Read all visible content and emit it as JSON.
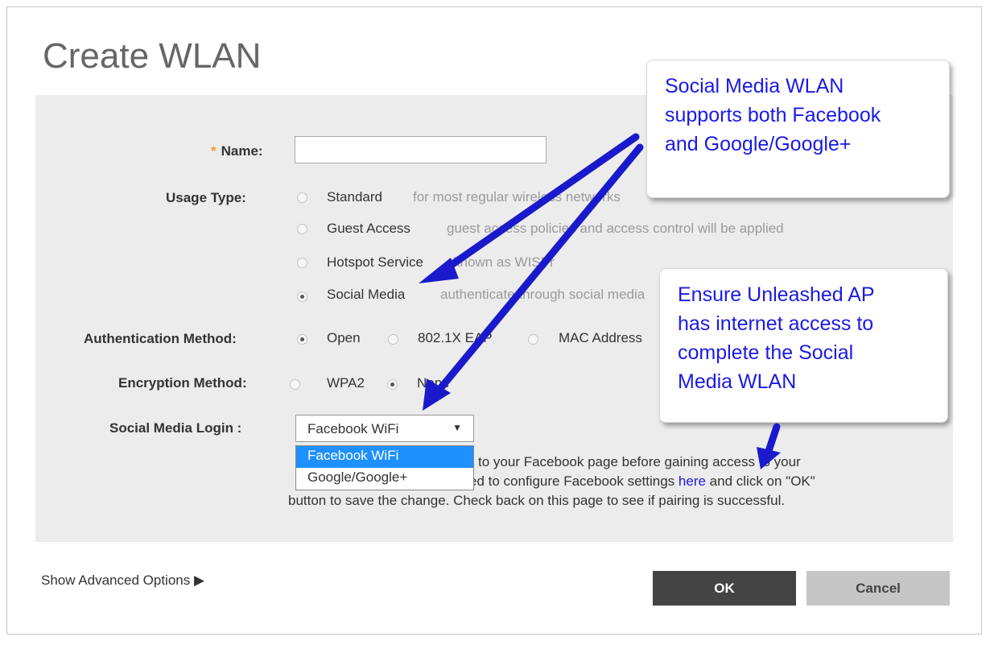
{
  "dialog": {
    "title": "Create WLAN"
  },
  "form": {
    "name_label": "Name:",
    "name_required": "*",
    "name_value": "",
    "usage_label": "Usage Type:",
    "usage_options": [
      {
        "label": "Standard",
        "hint": "for most regular wireless networks",
        "checked": false
      },
      {
        "label": "Guest Access",
        "hint": "guest access policies and access control will be applied",
        "checked": false
      },
      {
        "label": "Hotspot Service",
        "hint": "known as WISPr",
        "checked": false
      },
      {
        "label": "Social Media",
        "hint": "authenticate through social media",
        "checked": true
      }
    ],
    "auth_label": "Authentication Method:",
    "auth_options": [
      {
        "label": "Open",
        "checked": true
      },
      {
        "label": "802.1X EAP",
        "checked": false
      },
      {
        "label": "MAC Address",
        "checked": false
      }
    ],
    "enc_label": "Encryption Method:",
    "enc_options": [
      {
        "label": "WPA2",
        "checked": false
      },
      {
        "label": "None",
        "checked": true
      }
    ],
    "social_label": "Social Media Login :",
    "social_selected": "Facebook WiFi",
    "social_options": [
      "Facebook WiFi",
      "Google/Google+"
    ],
    "note_part1": "to your Facebook page before gaining access to your",
    "note_part2": "ed to configure Facebook settings",
    "note_link": "here",
    "note_part3": "and click on \"OK\"",
    "note_part4": "button to save the change. Check back on this page to see if pairing is successful."
  },
  "footer": {
    "advanced": "Show Advanced Options",
    "ok": "OK",
    "cancel": "Cancel"
  },
  "callouts": {
    "first": [
      "Social Media WLAN",
      "supports both Facebook",
      "and Google/Google+"
    ],
    "second": [
      "Ensure Unleashed AP",
      "has internet access to",
      "complete the Social",
      "Media WLAN"
    ]
  },
  "colors": {
    "callout_text": "#1a1ae6",
    "arrow": "#1a1acc",
    "ok_button": "#444444",
    "cancel_button": "#c6c6c6",
    "dropdown_highlight": "#1e90ff"
  }
}
